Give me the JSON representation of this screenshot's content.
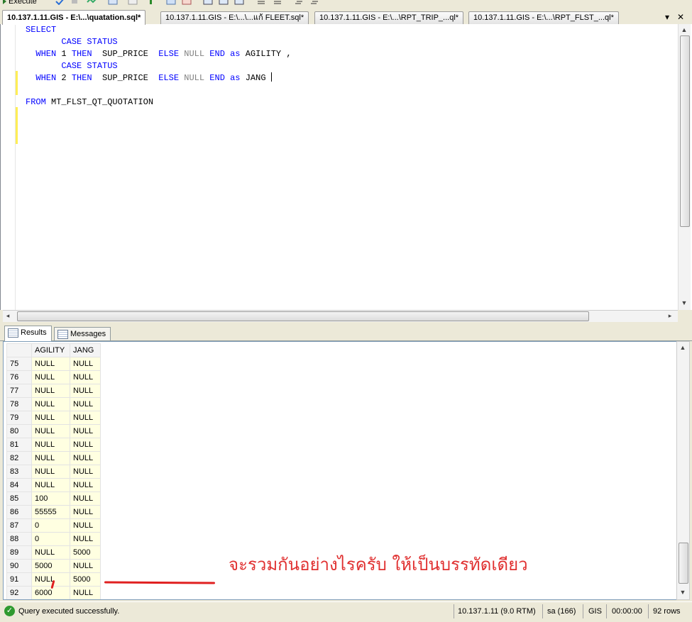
{
  "toolbar": {
    "execute_label": "Execute"
  },
  "tabs": [
    {
      "label": "10.137.1.11.GIS - E:\\...\\quatation.sql*",
      "active": true
    },
    {
      "label": "10.137.1.11.GIS - E:\\...\\...แก้ FLEET.sql*",
      "active": false
    },
    {
      "label": "10.137.1.11.GIS - E:\\...\\RPT_TRIP_...ql*",
      "active": false
    },
    {
      "label": "10.137.1.11.GIS - E:\\...\\RPT_FLST_...ql*",
      "active": false
    }
  ],
  "tab_controls": {
    "dropdown": "▾",
    "close": "✕"
  },
  "editor": {
    "code": {
      "select": "SELECT",
      "case1": "CASE STATUS",
      "when": "WHEN",
      "num1": "1",
      "num2": "2",
      "then": "THEN",
      "col": "SUP_PRICE",
      "else": "ELSE",
      "null": "NULL",
      "end": "END",
      "as": "as",
      "alias1": "AGILITY",
      "comma": ",",
      "alias2": "JANG",
      "from": "FROM",
      "table": "MT_FLST_QT_QUOTATION"
    }
  },
  "result_tabs": {
    "results": "Results",
    "messages": "Messages"
  },
  "grid": {
    "columns": [
      "",
      "AGILITY",
      "JANG"
    ],
    "rows": [
      [
        "75",
        "NULL",
        "NULL"
      ],
      [
        "76",
        "NULL",
        "NULL"
      ],
      [
        "77",
        "NULL",
        "NULL"
      ],
      [
        "78",
        "NULL",
        "NULL"
      ],
      [
        "79",
        "NULL",
        "NULL"
      ],
      [
        "80",
        "NULL",
        "NULL"
      ],
      [
        "81",
        "NULL",
        "NULL"
      ],
      [
        "82",
        "NULL",
        "NULL"
      ],
      [
        "83",
        "NULL",
        "NULL"
      ],
      [
        "84",
        "NULL",
        "NULL"
      ],
      [
        "85",
        "100",
        "NULL"
      ],
      [
        "86",
        "55555",
        "NULL"
      ],
      [
        "87",
        "0",
        "NULL"
      ],
      [
        "88",
        "0",
        "NULL"
      ],
      [
        "89",
        "NULL",
        "5000"
      ],
      [
        "90",
        "5000",
        "NULL"
      ],
      [
        "91",
        "NULL",
        "5000"
      ],
      [
        "92",
        "6000",
        "NULL"
      ]
    ]
  },
  "annotation": {
    "text": "จะรวมกันอย่างไรครับ ให้เป็นบรรทัดเดียว",
    "color": "#e03030"
  },
  "status": {
    "message": "Query executed successfully.",
    "server": "10.137.1.11 (9.0 RTM)",
    "user": "sa (166)",
    "db": "GIS",
    "time": "00:00:00",
    "rows": "92 rows"
  }
}
